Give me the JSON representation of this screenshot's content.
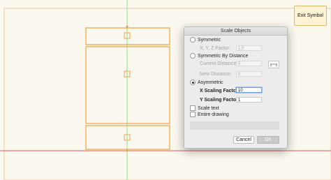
{
  "toolbar": {
    "exit_symbol_label": "Exit Symbol"
  },
  "dialog": {
    "title": "Scale Objects",
    "symmetric": {
      "label": "Symmetric",
      "checked": false
    },
    "xyz_factor": {
      "label": "X, Y, Z Factor:",
      "value": "1.0",
      "enabled": false
    },
    "symmetric_by_distance": {
      "label": "Symmetric By Distance",
      "checked": false
    },
    "current_distance": {
      "label": "Current Distance:",
      "value": "0",
      "enabled": false
    },
    "new_distance": {
      "label": "New Distance:",
      "value": "0",
      "enabled": false
    },
    "asymmetric": {
      "label": "Asymmetric",
      "checked": true
    },
    "x_scaling": {
      "label": "X Scaling Factor:",
      "value": "10"
    },
    "y_scaling": {
      "label": "Y Scaling Factor:",
      "value": "1"
    },
    "scale_text": {
      "label": "Scale text",
      "checked": false
    },
    "entire_drawing": {
      "label": "Entire drawing",
      "checked": false
    },
    "cancel_label": "Cancel",
    "ok_label": "OK"
  },
  "colors": {
    "canvas_background": "#fbf8ef",
    "guide_green": "#8fe08f",
    "guide_red": "#e05a5a",
    "shape_orange": "#f0a040"
  }
}
